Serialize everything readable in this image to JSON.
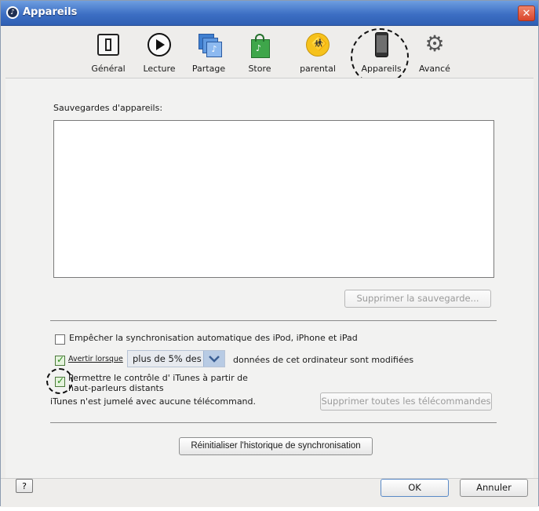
{
  "window": {
    "title": "Appareils"
  },
  "toolbar": {
    "items": [
      {
        "label": "Général",
        "icon": "switch-icon"
      },
      {
        "label": "Lecture",
        "icon": "play-icon"
      },
      {
        "label": "Partage",
        "icon": "share-icon"
      },
      {
        "label": "Store",
        "icon": "shopping-bag-icon"
      },
      {
        "label": "parental",
        "icon": "parental-icon"
      },
      {
        "label": "Appareils",
        "icon": "iphone-icon",
        "selected": true
      },
      {
        "label": "Avancé",
        "icon": "gear-icon"
      }
    ]
  },
  "backups": {
    "label": "Sauvegardes d'appareils:",
    "delete_button": "Supprimer la sauvegarde..."
  },
  "options": {
    "prevent_sync": {
      "label": "Empêcher la synchronisation automatique des iPod, iPhone et iPad",
      "checked": false
    },
    "warn_when": {
      "label": "Avertir lorsque",
      "select_value": "plus de 5% des",
      "suffix": "données de cet ordinateur sont modifiées",
      "checked": true
    },
    "allow_control": {
      "label_line1": "Permettre le contrôle d' iTunes à partir de",
      "label_line2": "haut-parleurs distants",
      "checked": true
    },
    "paired_status": "iTunes n'est jumelé avec aucune télécommand.",
    "delete_remotes_button": "Supprimer toutes les télécommandes"
  },
  "reset_button": "Réinitialiser l'historique de synchronisation",
  "footer": {
    "help": "?",
    "ok": "OK",
    "cancel": "Annuler"
  },
  "colors": {
    "titlebar": "#3d6fc4",
    "check": "#2e8c1e",
    "select_arrow": "#b8cbe4"
  }
}
